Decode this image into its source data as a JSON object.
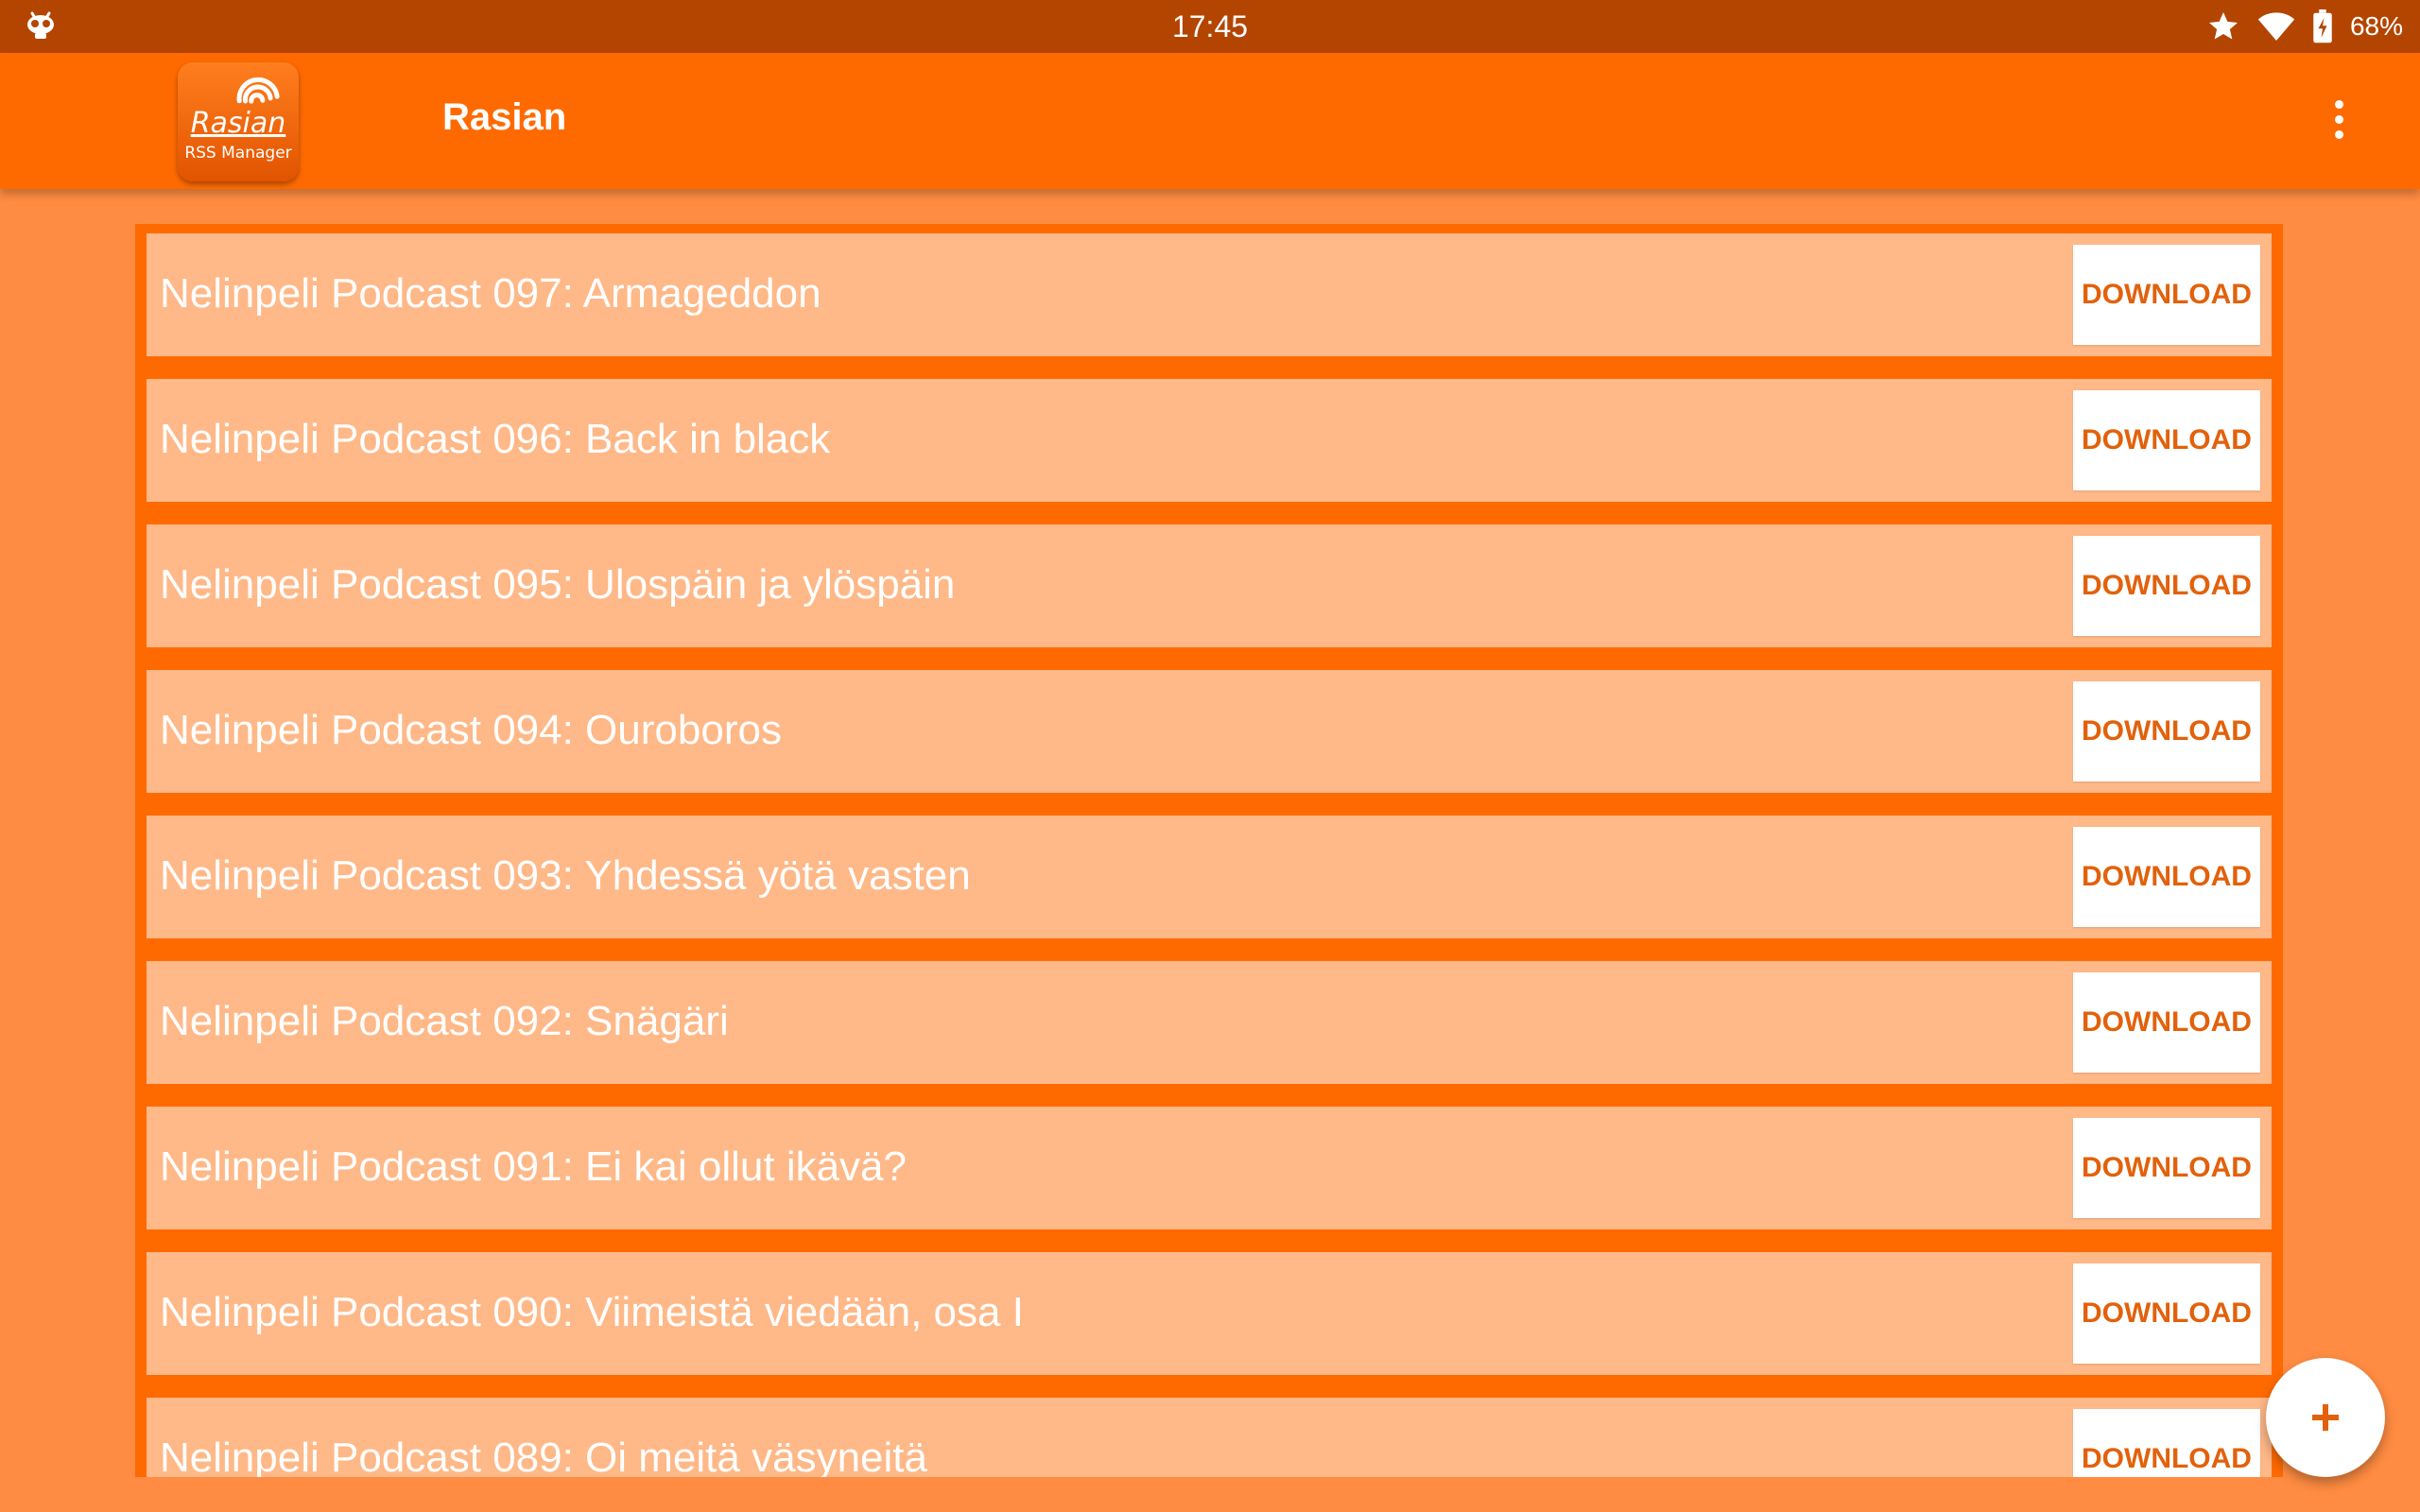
{
  "status_bar": {
    "time": "17:45",
    "battery": "68%",
    "icons": [
      "robot-icon",
      "star-icon",
      "wifi-icon",
      "battery-charging-icon"
    ]
  },
  "app_bar": {
    "logo": {
      "name": "Rasian",
      "subtitle": "RSS Manager"
    },
    "title": "Rasian",
    "menu_icon": "more-vert-icon"
  },
  "episodes": [
    {
      "title": "Nelinpeli Podcast 097: Armageddon",
      "action": "DOWNLOAD"
    },
    {
      "title": "Nelinpeli Podcast 096: Back in black",
      "action": "DOWNLOAD"
    },
    {
      "title": "Nelinpeli Podcast 095: Ulospäin ja ylöspäin",
      "action": "DOWNLOAD"
    },
    {
      "title": "Nelinpeli Podcast 094: Ouroboros",
      "action": "DOWNLOAD"
    },
    {
      "title": "Nelinpeli Podcast 093: Yhdessä yötä vasten",
      "action": "DOWNLOAD"
    },
    {
      "title": "Nelinpeli Podcast 092: Snägäri",
      "action": "DOWNLOAD"
    },
    {
      "title": "Nelinpeli Podcast 091: Ei kai ollut ikävä?",
      "action": "DOWNLOAD"
    },
    {
      "title": "Nelinpeli Podcast 090: Viimeistä viedään, osa I",
      "action": "DOWNLOAD"
    },
    {
      "title": "Nelinpeli Podcast 089: Oi meitä väsyneitä",
      "action": "DOWNLOAD"
    }
  ],
  "fab": {
    "icon": "plus-icon"
  },
  "colors": {
    "status_bar": "#B34500",
    "app_bar": "#FF6A00",
    "background": "#FF8C42",
    "list_item": "#FFB887",
    "accent_text": "#E2610B"
  }
}
